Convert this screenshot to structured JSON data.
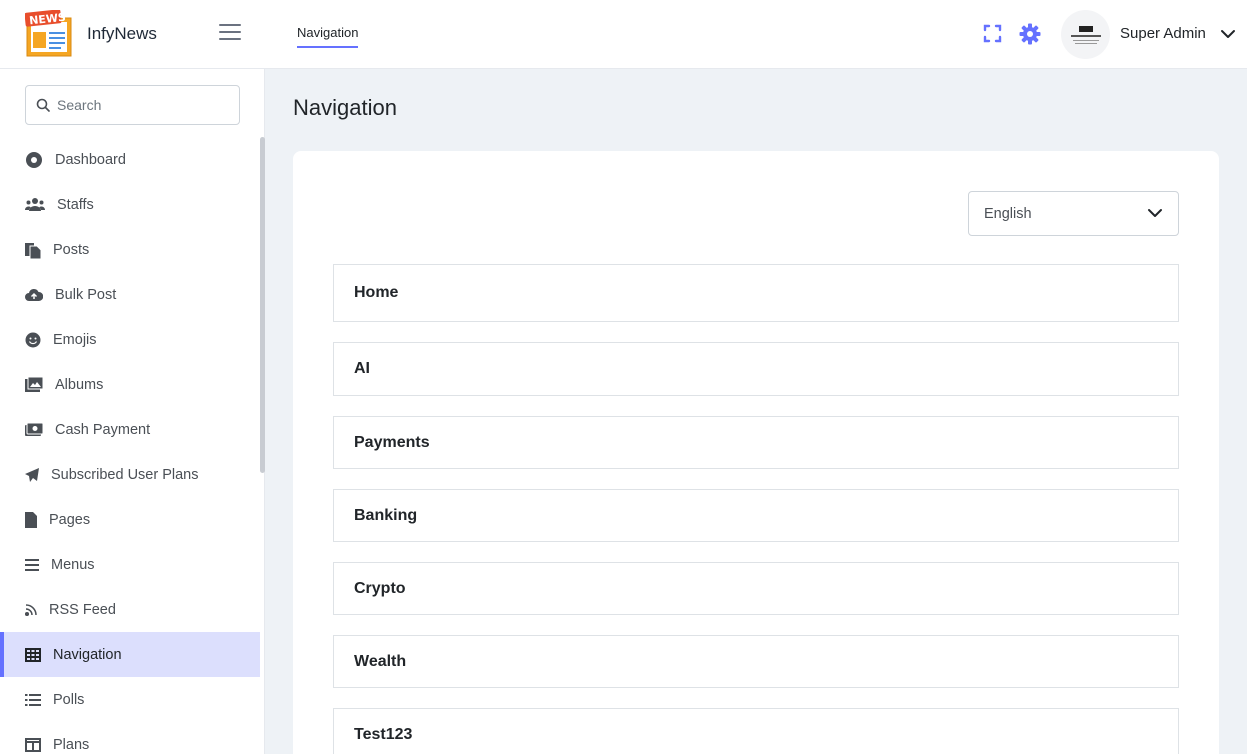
{
  "app": {
    "name": "InfyNews",
    "logo_text": "NEWS"
  },
  "header": {
    "active_tab": "Navigation",
    "user_name": "Super Admin"
  },
  "sidebar": {
    "search_placeholder": "Search",
    "items": [
      {
        "label": "Dashboard",
        "icon": "dashboard-icon"
      },
      {
        "label": "Staffs",
        "icon": "users-icon"
      },
      {
        "label": "Posts",
        "icon": "posts-icon"
      },
      {
        "label": "Bulk Post",
        "icon": "cloud-upload-icon"
      },
      {
        "label": "Emojis",
        "icon": "smile-icon"
      },
      {
        "label": "Albums",
        "icon": "images-icon"
      },
      {
        "label": "Cash Payment",
        "icon": "money-icon"
      },
      {
        "label": "Subscribed User Plans",
        "icon": "paper-plane-icon"
      },
      {
        "label": "Pages",
        "icon": "page-icon"
      },
      {
        "label": "Menus",
        "icon": "menu-icon"
      },
      {
        "label": "RSS Feed",
        "icon": "rss-icon"
      },
      {
        "label": "Navigation",
        "icon": "table-icon",
        "active": true
      },
      {
        "label": "Polls",
        "icon": "list-icon"
      },
      {
        "label": "Plans",
        "icon": "columns-icon"
      }
    ]
  },
  "main": {
    "title": "Navigation",
    "language": "English",
    "rows": [
      "Home",
      "AI",
      "Payments",
      "Banking",
      "Crypto",
      "Wealth",
      "Test123"
    ]
  },
  "colors": {
    "accent": "#6571ff",
    "active_bg": "#dcdffd",
    "page_bg": "#eef2f6"
  }
}
